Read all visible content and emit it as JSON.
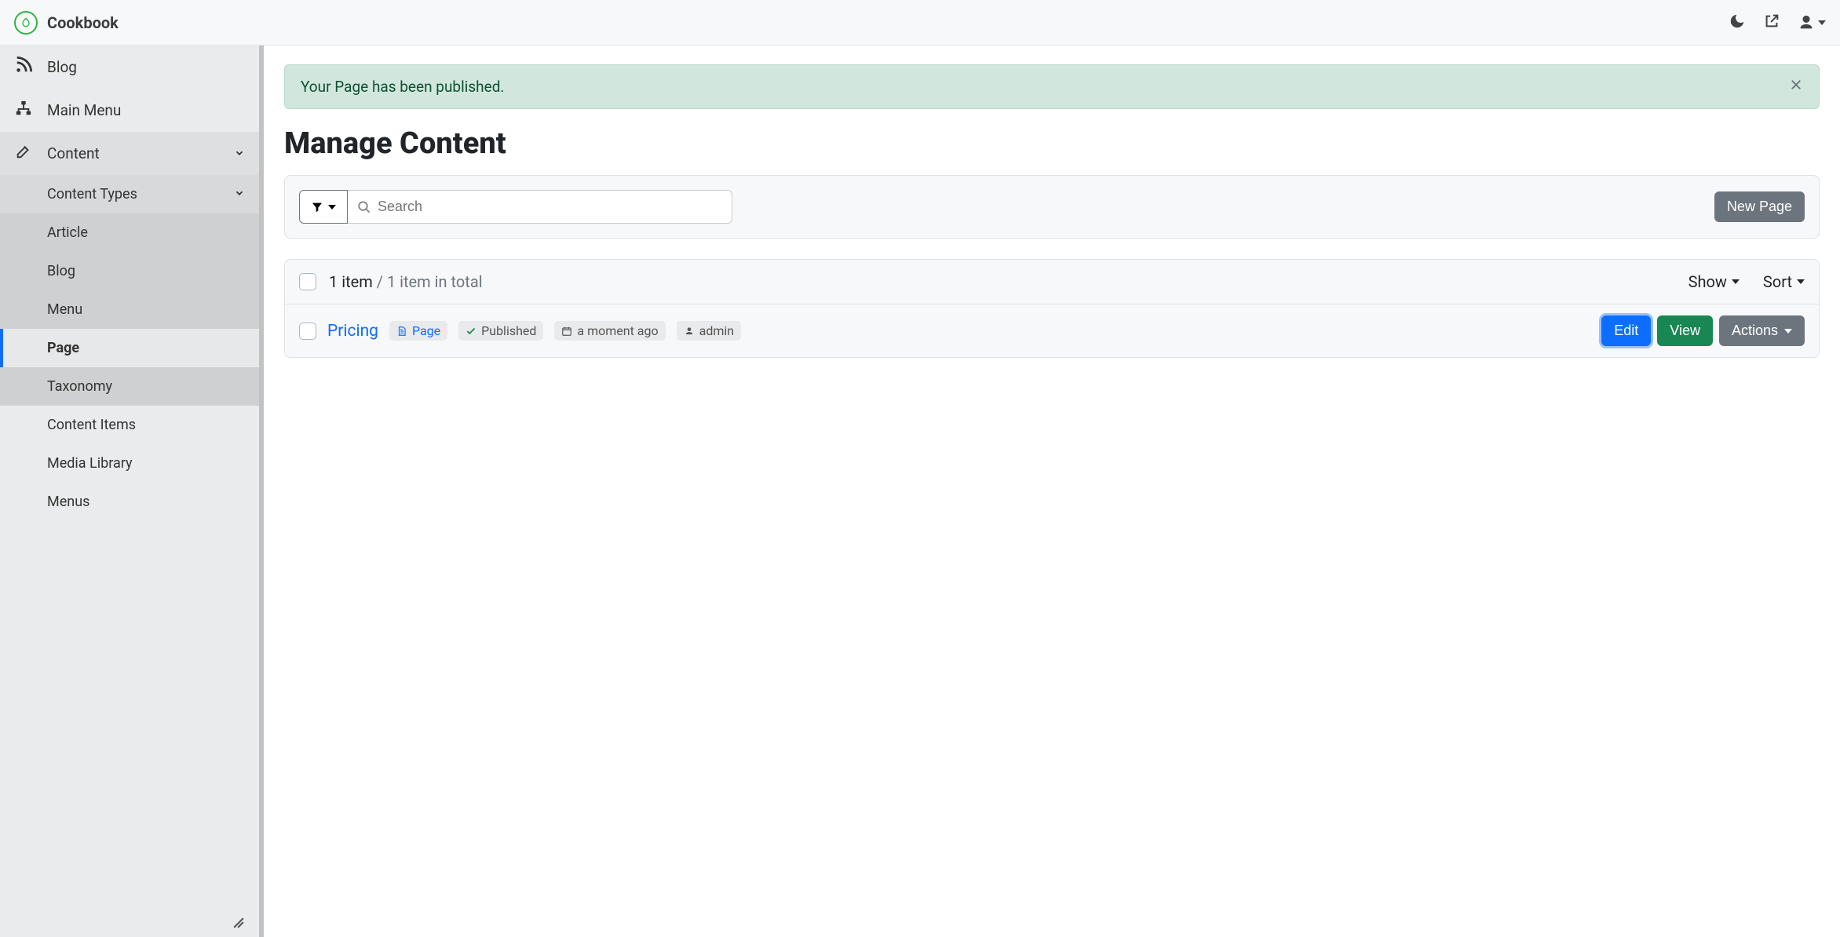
{
  "brand": {
    "name": "Cookbook"
  },
  "sidebar": {
    "items": [
      {
        "label": "Blog"
      },
      {
        "label": "Main Menu"
      },
      {
        "label": "Content"
      }
    ],
    "content_types_label": "Content Types",
    "types": [
      {
        "label": "Article"
      },
      {
        "label": "Blog"
      },
      {
        "label": "Menu"
      },
      {
        "label": "Page"
      },
      {
        "label": "Taxonomy"
      }
    ],
    "extras": [
      {
        "label": "Content Items"
      },
      {
        "label": "Media Library"
      },
      {
        "label": "Menus"
      }
    ]
  },
  "alert": {
    "message": "Your Page has been published."
  },
  "page": {
    "title": "Manage Content"
  },
  "toolbar": {
    "search_placeholder": "Search",
    "new_button": "New Page"
  },
  "list": {
    "count_primary": "1 item",
    "count_separator": " / ",
    "count_secondary": "1 item in total",
    "show_label": "Show",
    "sort_label": "Sort"
  },
  "row": {
    "title": "Pricing",
    "type": "Page",
    "status": "Published",
    "time": "a moment ago",
    "author": "admin",
    "edit": "Edit",
    "view": "View",
    "actions": "Actions"
  }
}
